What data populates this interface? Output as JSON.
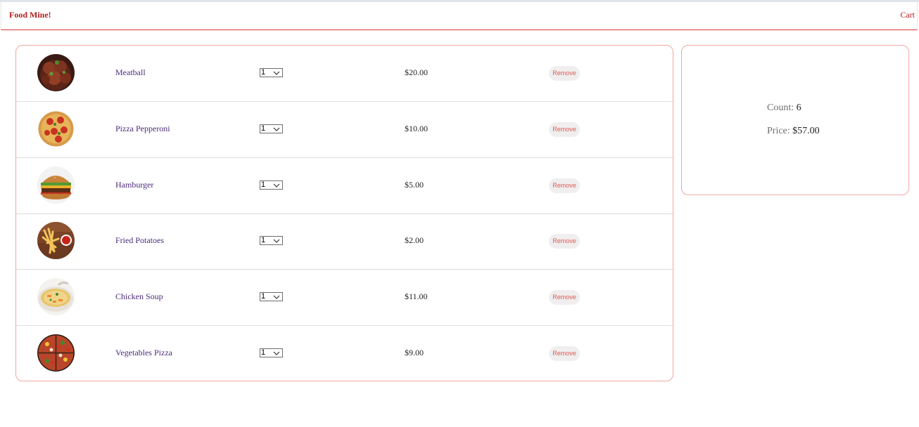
{
  "header": {
    "logo": "Food Mine!",
    "cart_link": "Cart"
  },
  "items": [
    {
      "name": "Meatball",
      "quantity": "1",
      "price": "$20.00",
      "remove_label": "Remove",
      "image_icon": "meatball-image"
    },
    {
      "name": "Pizza Pepperoni",
      "quantity": "1",
      "price": "$10.00",
      "remove_label": "Remove",
      "image_icon": "pizza-pepperoni-image"
    },
    {
      "name": "Hamburger",
      "quantity": "1",
      "price": "$5.00",
      "remove_label": "Remove",
      "image_icon": "hamburger-image"
    },
    {
      "name": "Fried Potatoes",
      "quantity": "1",
      "price": "$2.00",
      "remove_label": "Remove",
      "image_icon": "fried-potatoes-image"
    },
    {
      "name": "Chicken Soup",
      "quantity": "1",
      "price": "$11.00",
      "remove_label": "Remove",
      "image_icon": "chicken-soup-image"
    },
    {
      "name": "Vegetables Pizza",
      "quantity": "1",
      "price": "$9.00",
      "remove_label": "Remove",
      "image_icon": "vegetables-pizza-image"
    }
  ],
  "summary": {
    "count_label": "Count:",
    "count_value": "6",
    "price_label": "Price:",
    "price_value": "$57.00"
  },
  "colors": {
    "accent": "#b21e1e",
    "border": "#f2a7a3",
    "item_name": "#4b2a7b",
    "remove_text": "#e05a55"
  }
}
